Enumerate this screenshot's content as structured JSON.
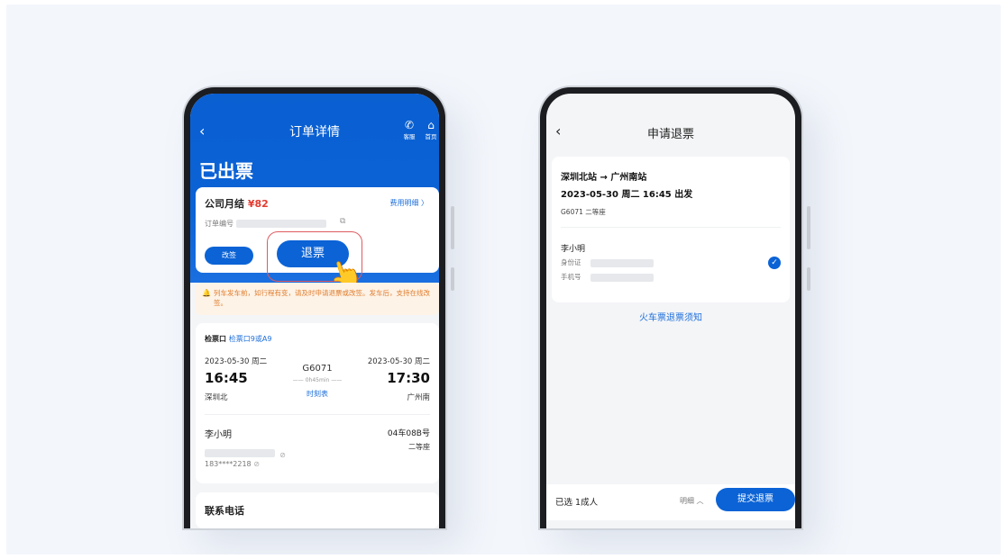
{
  "left_phone": {
    "nav": {
      "back_icon": "‹",
      "title": "订单详情",
      "service_label": "客服",
      "service_icon": "✆",
      "home_label": "首页",
      "home_icon": "⌂"
    },
    "status": "已出票",
    "payment_card": {
      "title": "公司月结",
      "amount": "¥82",
      "fee_detail_link": "费用明细 〉",
      "order_no_label": "订单编号",
      "change_button": "改签",
      "refund_button": "退票"
    },
    "notice": "列车发车前，如行程有变，请及时申请退票或改签。发车后，支持在线改签。",
    "trip_card": {
      "gate_label": "检票口",
      "gate_value": "检票口9或A9",
      "depart_date": "2023-05-30 周二",
      "depart_time": "16:45",
      "depart_station": "深圳北",
      "train_no": "G6071",
      "duration": "0h45min",
      "timetable_link": "时刻表",
      "arrive_date": "2023-05-30 周二",
      "arrive_time": "17:30",
      "arrive_station": "广州南",
      "passenger_name": "李小明",
      "seat": "04车08B号",
      "seat_class": "二等座",
      "phone": "183****2218",
      "eye_icon": "⊘"
    },
    "contact_title": "联系电话"
  },
  "right_phone": {
    "nav": {
      "back_icon": "‹",
      "title": "申请退票"
    },
    "route": "深圳北站 → 广州南站",
    "datetime": "2023-05-30 周二 16:45 出发",
    "train_class": "G6071 二等座",
    "passenger_name": "李小明",
    "id_label": "身份证",
    "phone_label": "手机号",
    "check_icon": "✓",
    "refund_notice_link": "火车票退票须知",
    "selected": "已选 1成人",
    "detail_toggle": "明细 ︿",
    "submit_button": "提交退票"
  }
}
